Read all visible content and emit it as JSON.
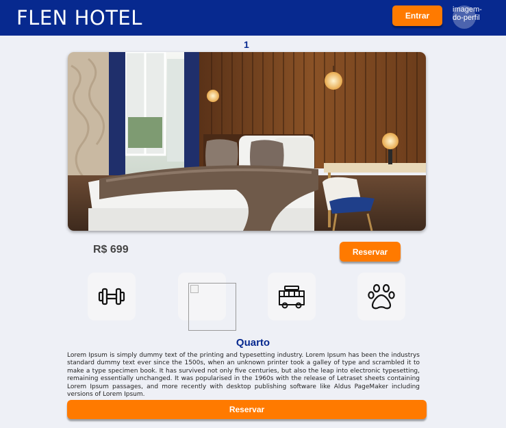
{
  "header": {
    "brand": "FLEN HOTEL",
    "login_label": "Entrar",
    "profile_image_alt": "imagem-do-perfil"
  },
  "room": {
    "number": "1",
    "price": "R$ 699",
    "reserve_label": "Reservar",
    "title": "Quarto",
    "description": "Lorem Ipsum is simply dummy text of the printing and typesetting industry. Lorem Ipsum has been the industrys standard dummy text ever since the 1500s, when an unknown printer took a galley of type and scrambled it to make a type specimen book. It has survived not only five centuries, but also the leap into electronic typesetting, remaining essentially unchanged. It was popularised in the 1960s with the release of Letraset sheets containing Lorem Ipsum passages, and more recently with desktop publishing software like Aldus PageMaker including versions of Lorem Ipsum.",
    "reserve_bottom_label": "Reservar"
  },
  "amenities": [
    {
      "icon": "dumbbell-icon"
    },
    {
      "icon": "broken-image-icon"
    },
    {
      "icon": "van-icon"
    },
    {
      "icon": "paw-icon"
    }
  ],
  "colors": {
    "header_bg": "#07298f",
    "accent": "#ff7a00",
    "page_bg": "#eef0f6",
    "title_text": "#07298f"
  }
}
